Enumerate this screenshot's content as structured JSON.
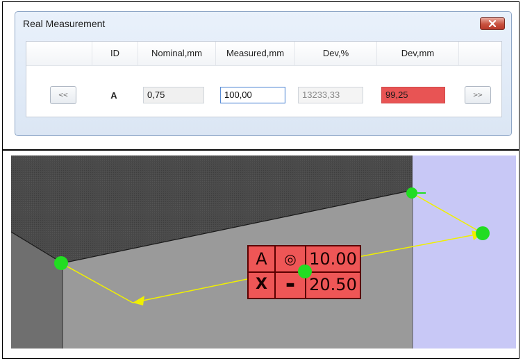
{
  "dialog": {
    "title": "Real Measurement",
    "close_icon": "close-x-icon"
  },
  "table": {
    "headers": [
      "ID",
      "Nominal,mm",
      "Measured,mm",
      "Dev,%",
      "Dev,mm"
    ],
    "prev_label": "<<",
    "next_label": ">>",
    "row": {
      "id": "A",
      "nominal": "0,75",
      "measured": "100,00",
      "dev_percent": "13233,33",
      "dev_mm": "99,25"
    }
  },
  "frame": {
    "datum": "A",
    "concentricity_symbol": "◎",
    "value_1": "10.00",
    "lower_left_symbol": "X",
    "lower_mid_symbol": "▬",
    "value_2": "20.50"
  },
  "colors": {
    "deviation_bad": "#e85454",
    "marker_green": "#22dd22",
    "leader_yellow": "#f0f000",
    "background_lavender": "#c8c8f6"
  }
}
